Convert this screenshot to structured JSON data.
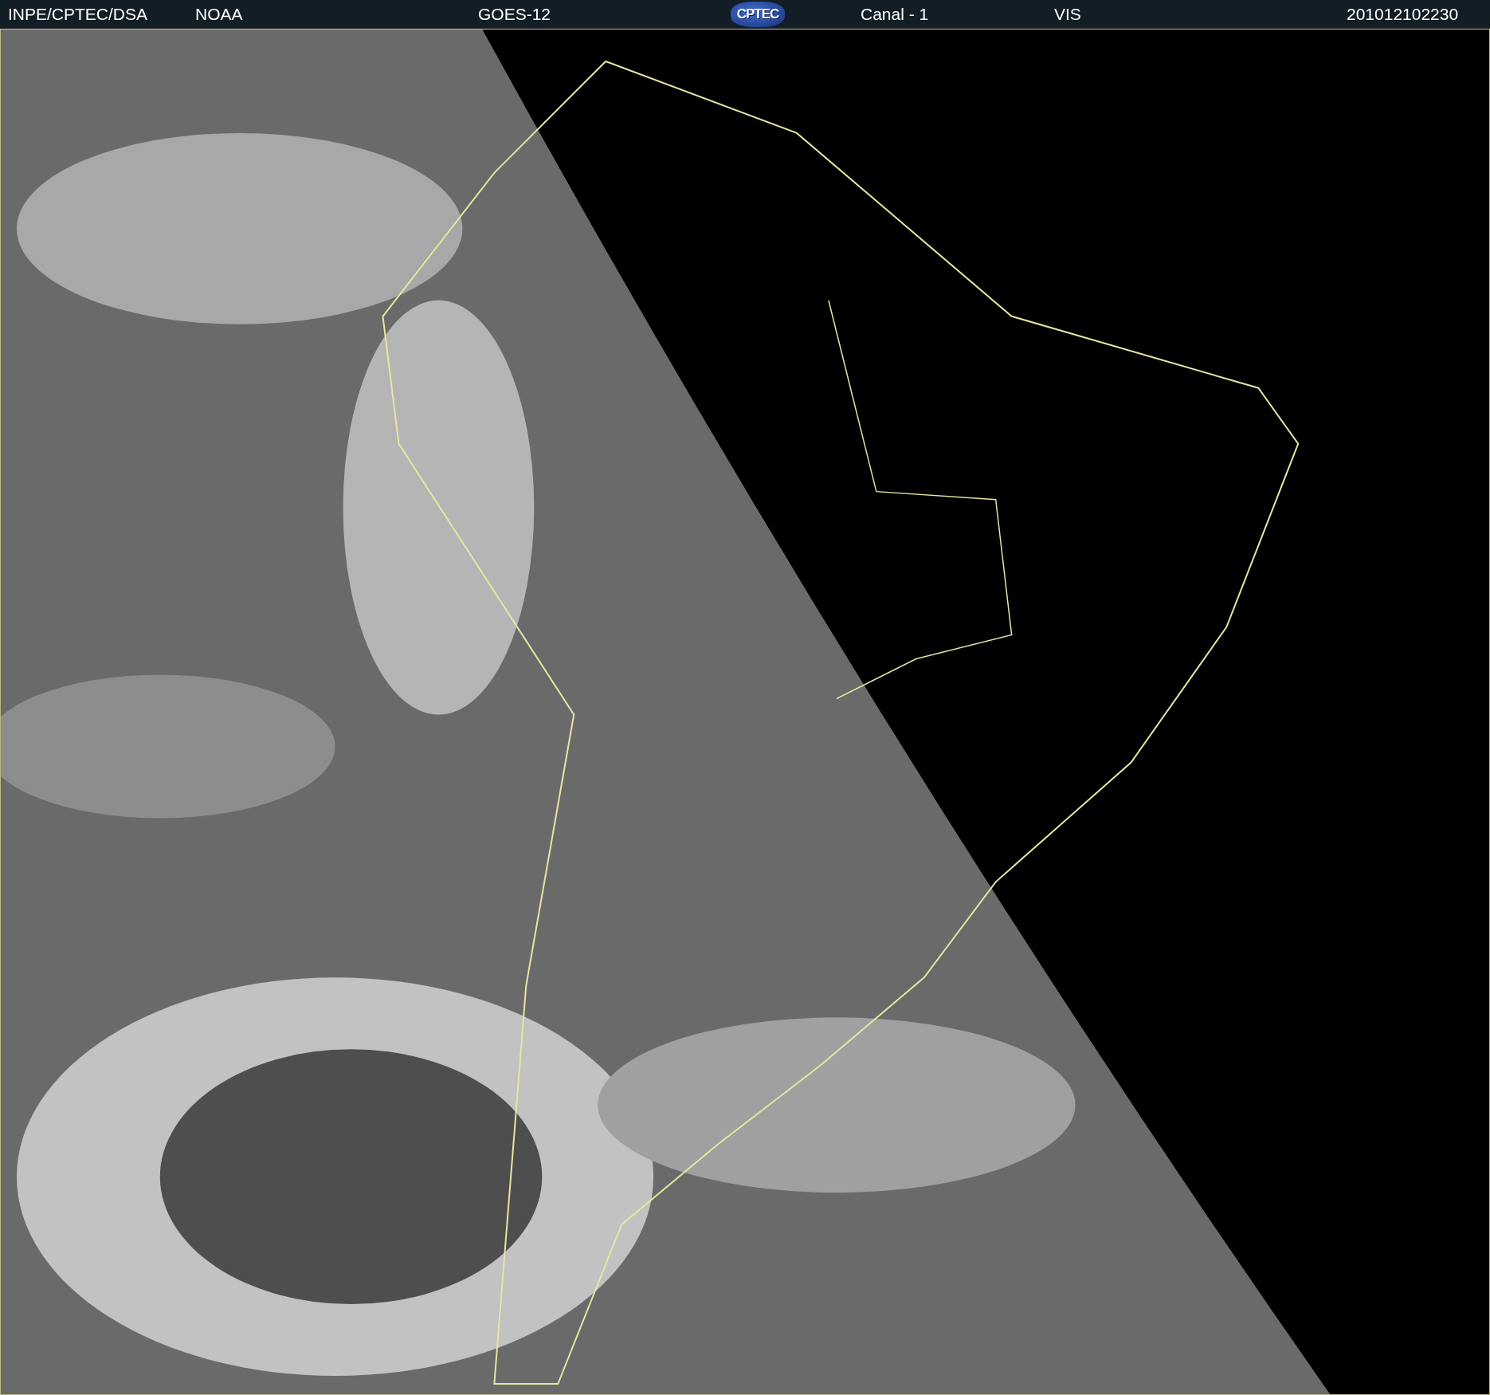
{
  "header": {
    "items": [
      {
        "kind": "text",
        "text": "INPE/CPTEC/DSA"
      },
      {
        "kind": "text",
        "text": "NOAA"
      },
      {
        "kind": "text",
        "text": "GOES-12"
      },
      {
        "kind": "logo",
        "text": "CPTEC"
      },
      {
        "kind": "text",
        "text": "Canal - 1"
      },
      {
        "kind": "text",
        "text": "VIS"
      },
      {
        "kind": "text",
        "text": "201012102230"
      }
    ]
  }
}
